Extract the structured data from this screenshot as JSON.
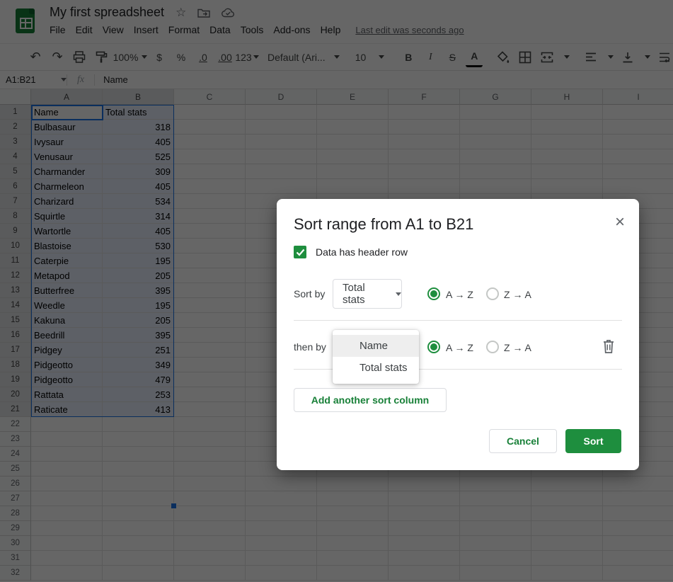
{
  "app": {
    "title": "My first spreadsheet",
    "menu": [
      "File",
      "Edit",
      "View",
      "Insert",
      "Format",
      "Data",
      "Tools",
      "Add-ons",
      "Help"
    ],
    "last_edit": "Last edit was seconds ago"
  },
  "icons": {
    "undo": "↶",
    "redo": "↷",
    "star": "☆"
  },
  "toolbar": {
    "zoom": "100%",
    "currency": "$",
    "percent": "%",
    "decrease_decimal": ".0",
    "increase_decimal": ".00",
    "number_format": "123",
    "font": "Default (Ari...",
    "font_size": "10",
    "bold": "B",
    "italic": "I",
    "strikethrough": "S",
    "text_color": "A"
  },
  "formula_bar": {
    "name_box": "A1:B21",
    "fx": "fx",
    "content": "Name"
  },
  "sheet": {
    "columns": [
      "A",
      "B",
      "C",
      "D",
      "E",
      "F",
      "G",
      "H",
      "I"
    ],
    "row_count": 32,
    "selected_range": "A1:B21",
    "headers": [
      "Name",
      "Total stats"
    ],
    "data": [
      {
        "name": "Bulbasaur",
        "total": "318"
      },
      {
        "name": "Ivysaur",
        "total": "405"
      },
      {
        "name": "Venusaur",
        "total": "525"
      },
      {
        "name": "Charmander",
        "total": "309"
      },
      {
        "name": "Charmeleon",
        "total": "405"
      },
      {
        "name": "Charizard",
        "total": "534"
      },
      {
        "name": "Squirtle",
        "total": "314"
      },
      {
        "name": "Wartortle",
        "total": "405"
      },
      {
        "name": "Blastoise",
        "total": "530"
      },
      {
        "name": "Caterpie",
        "total": "195"
      },
      {
        "name": "Metapod",
        "total": "205"
      },
      {
        "name": "Butterfree",
        "total": "395"
      },
      {
        "name": "Weedle",
        "total": "195"
      },
      {
        "name": "Kakuna",
        "total": "205"
      },
      {
        "name": "Beedrill",
        "total": "395"
      },
      {
        "name": "Pidgey",
        "total": "251"
      },
      {
        "name": "Pidgeotto",
        "total": "349"
      },
      {
        "name": "Pidgeotto",
        "total": "479"
      },
      {
        "name": "Rattata",
        "total": "253"
      },
      {
        "name": "Raticate",
        "total": "413"
      }
    ]
  },
  "dialog": {
    "title": "Sort range from A1 to B21",
    "close": "×",
    "header_checkbox_label": "Data has header row",
    "sort_by_label": "Sort by",
    "sort_by_value": "Total stats",
    "then_by_label": "then by",
    "asc_label": "A → Z",
    "desc_label": "Z → A",
    "menu_items": [
      "Name",
      "Total stats"
    ],
    "add_button": "Add another sort column",
    "cancel_button": "Cancel",
    "sort_button": "Sort"
  },
  "colors": {
    "accent_green": "#1e8e3e",
    "green_text": "#188038",
    "selection_blue": "#1a73e8",
    "range_fill": "#e8f0fe"
  }
}
